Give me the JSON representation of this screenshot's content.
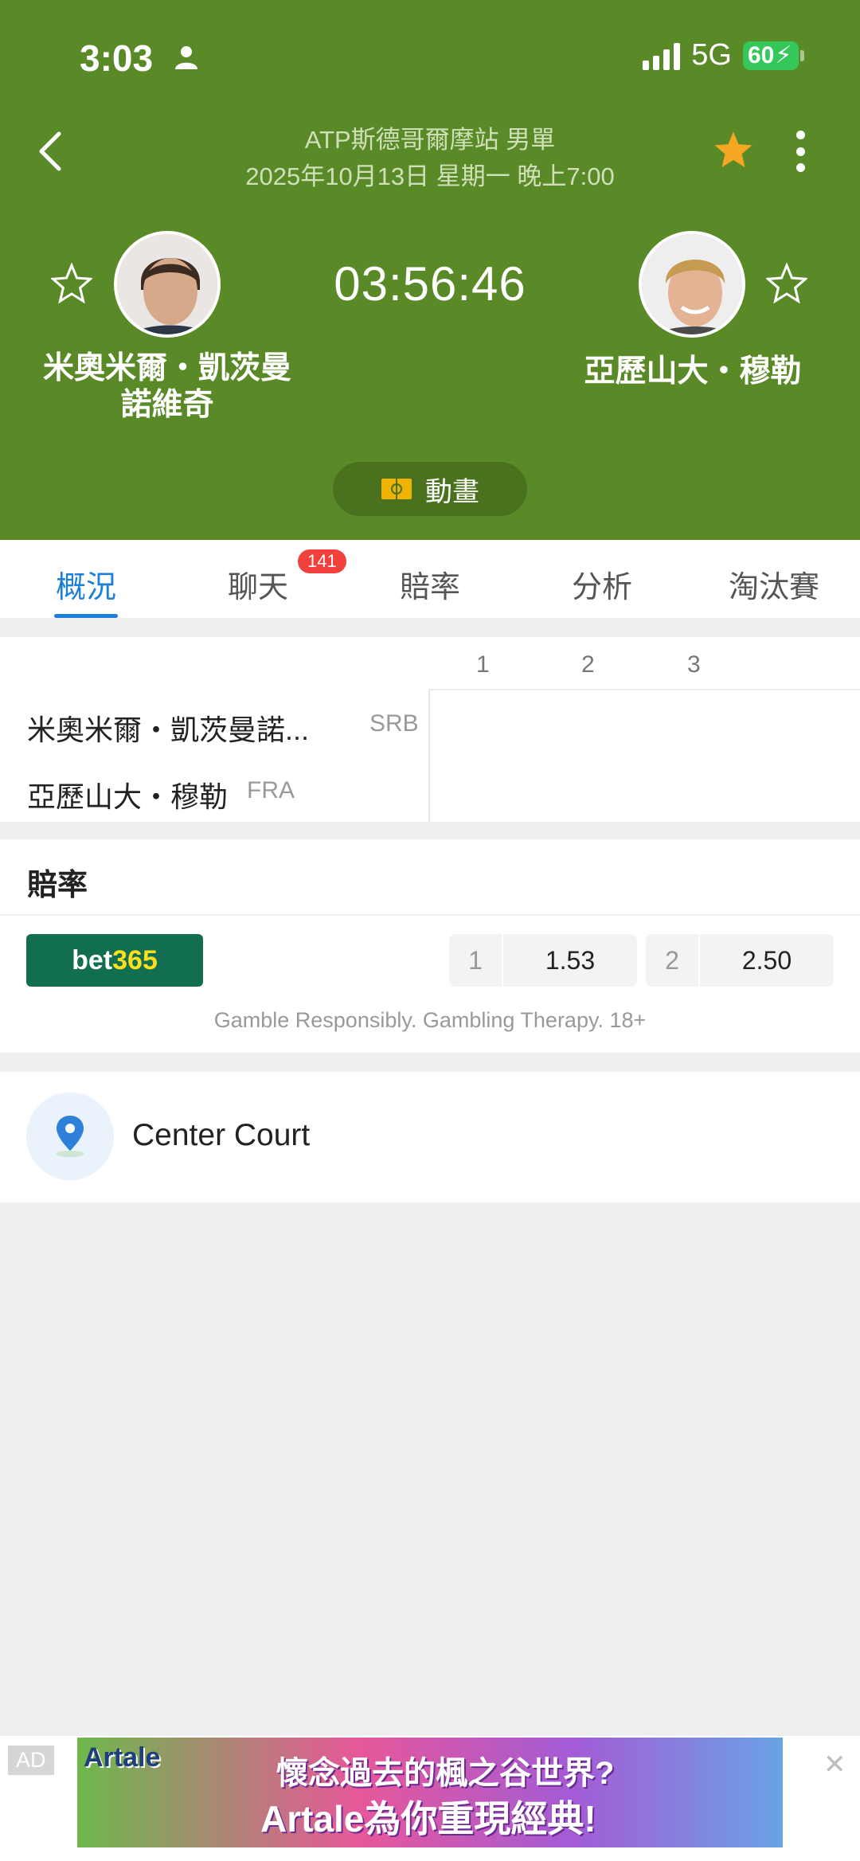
{
  "status_bar": {
    "time": "3:03",
    "network": "5G",
    "battery": "60"
  },
  "header": {
    "tournament": "ATP斯德哥爾摩站 男單",
    "datetime": "2025年10月13日 星期一 晚上7:00",
    "timer": "03:56:46",
    "animation_label": "動畫",
    "player1_name_line1": "米奧米爾・凱茨曼",
    "player1_name_line2": "諾維奇",
    "player2_name": "亞歷山大・穆勒"
  },
  "tabs": [
    {
      "label": "概況",
      "active": true
    },
    {
      "label": "聊天",
      "badge": "141"
    },
    {
      "label": "賠率"
    },
    {
      "label": "分析"
    },
    {
      "label": "淘汰賽"
    }
  ],
  "scoreboard": {
    "sets": [
      "1",
      "2",
      "3"
    ],
    "players": [
      {
        "name": "米奧米爾・凱茨曼諾...",
        "code": "SRB"
      },
      {
        "name": "亞歷山大・穆勒",
        "code": "FRA"
      }
    ]
  },
  "odds": {
    "title": "賠率",
    "bookmaker": {
      "part1": "bet",
      "part2": "365"
    },
    "home_key": "1",
    "home_value": "1.53",
    "away_key": "2",
    "away_value": "2.50",
    "disclaimer": "Gamble Responsibly. Gambling Therapy. 18+"
  },
  "venue": {
    "name": "Center Court"
  },
  "ad": {
    "tag": "AD",
    "brand": "Artale",
    "line1": "懷念過去的楓之谷世界?",
    "line2": "Artale為你重現經典!"
  },
  "colors": {
    "header_bg": "#5a8a27",
    "accent": "#1e7fd6",
    "star": "#f5a623",
    "badge": "#f2403c"
  }
}
